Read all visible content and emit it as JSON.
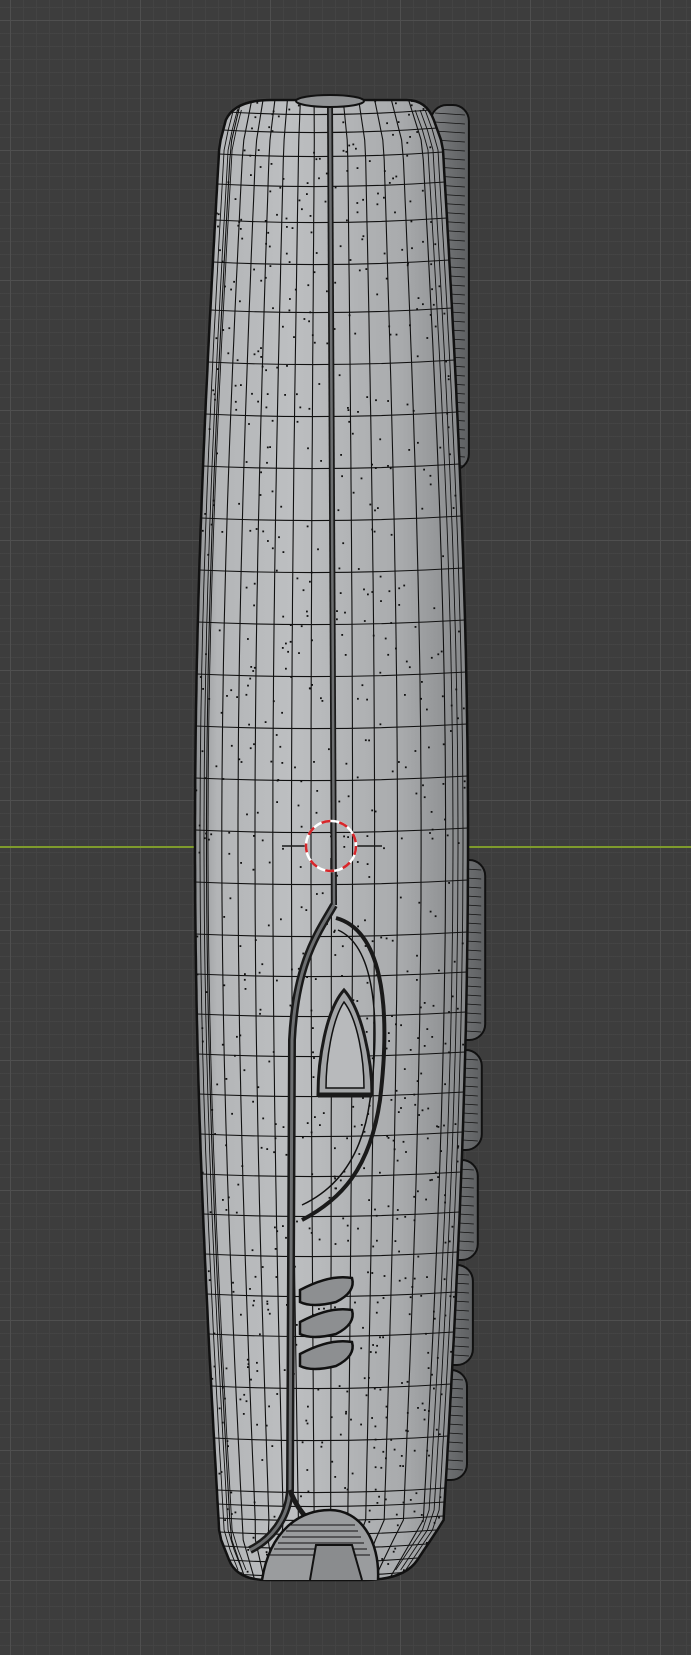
{
  "viewport": {
    "background": "#3d3d3d",
    "grid_major": "#505050",
    "grid_minor": "#444444",
    "axis_color": "#7e9a2c"
  },
  "model": {
    "body_color": "#a7a9ab",
    "edge_color": "#111111",
    "highlight_color": "#c9cacb",
    "shadow_color": "#7c7e80"
  },
  "cursor_3d": {
    "ring_red": "#d7262a",
    "ring_white": "#ffffff",
    "crosshair_color": "#1a1a1a"
  },
  "icons": {
    "cursor": "3d-cursor-icon"
  }
}
